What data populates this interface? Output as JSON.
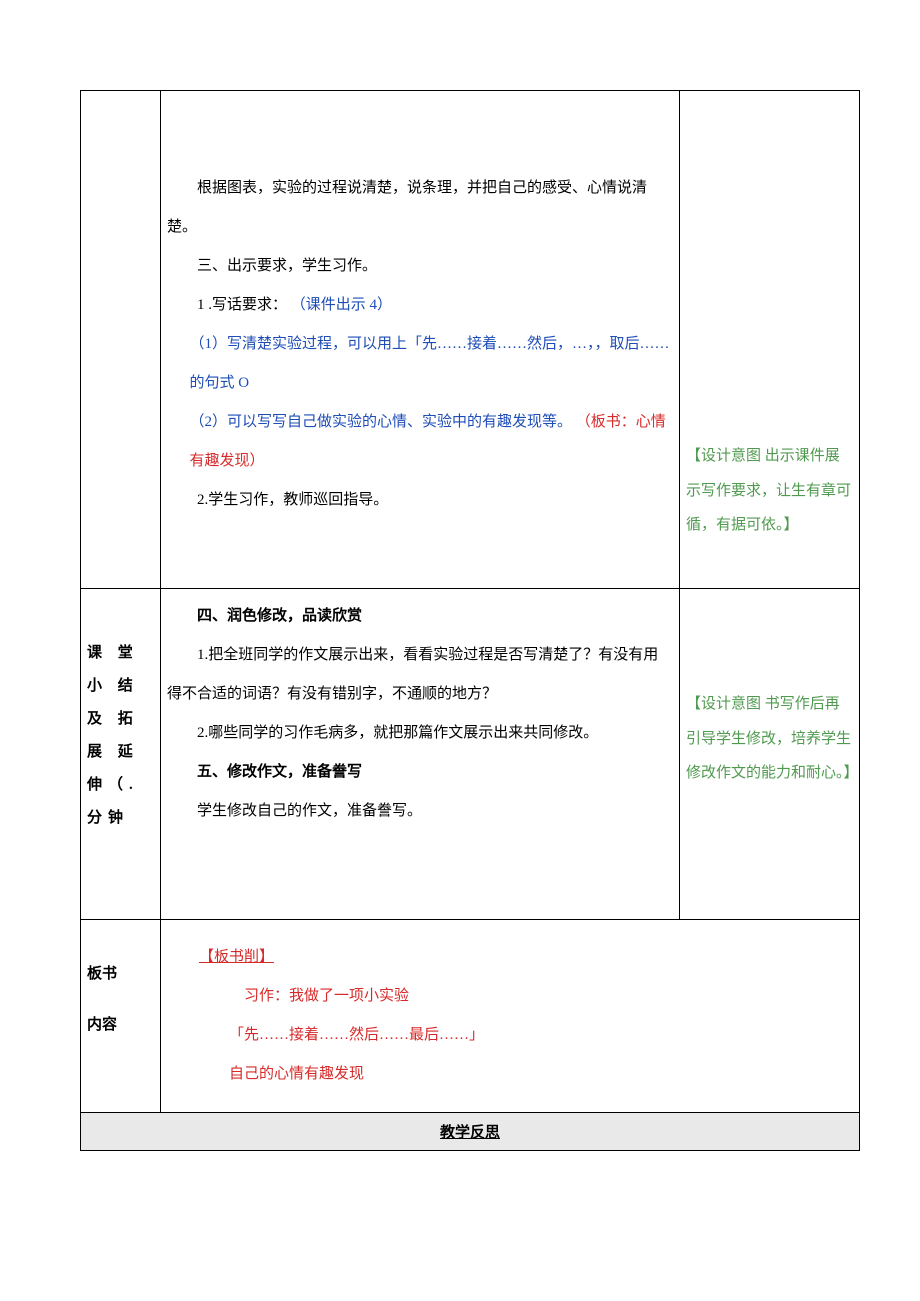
{
  "row1": {
    "p1": "根据图表，实验的过程说清楚，说条理，并把自己的感受、心情说清楚。",
    "p2": "三、出示要求，学生习作。",
    "p3_plain": "1 .写话要求：",
    "p3_blue": "（课件出示 4）",
    "p4": "（1）写清楚实验过程，可以用上「先……接着……然后，…，，取后……的句式 O",
    "p5_blue": "（2）可以写写自己做实验的心情、实验中的有趣发现等。",
    "p5_red_a": "（板书：",
    "p5_red_b": "心情有趣发现）",
    "p6": "2.学生习作，教师巡回指导。",
    "green_label": "【设计意图",
    "green_rest": " 出示课件展示写作要求，让生有章可循，有据可依。】"
  },
  "row2": {
    "sideA": "课 堂 小 结",
    "sideB": "及 拓 展 延",
    "sideC": "伸（.",
    "sideD": "分钟",
    "h1": "四、润色修改，品读欣赏",
    "p1": "1.把全班同学的作文展示出来，看看实验过程是否写清楚了？有没有用得不合适的词语？有没有错别字，不通顺的地方？",
    "p2": "2.哪些同学的习作毛病多，就把那篇作文展示出来共同修改。",
    "h2": "五、修改作文，准备誊写",
    "p3": "学生修改自己的作文，准备誊写。",
    "green_label": "【设计意图",
    "green_rest": " 书写作后再引导学生修改，培养学生修改作文的能力和耐心。】"
  },
  "row3": {
    "sideA": "板书",
    "sideB": "内容",
    "label": "【板书削】",
    "l1": "习作：我做了一项小实验",
    "l2": "「先……接着……然后……最后……」",
    "l3": "自己的心情有趣发现"
  },
  "reflection": "教学反思"
}
